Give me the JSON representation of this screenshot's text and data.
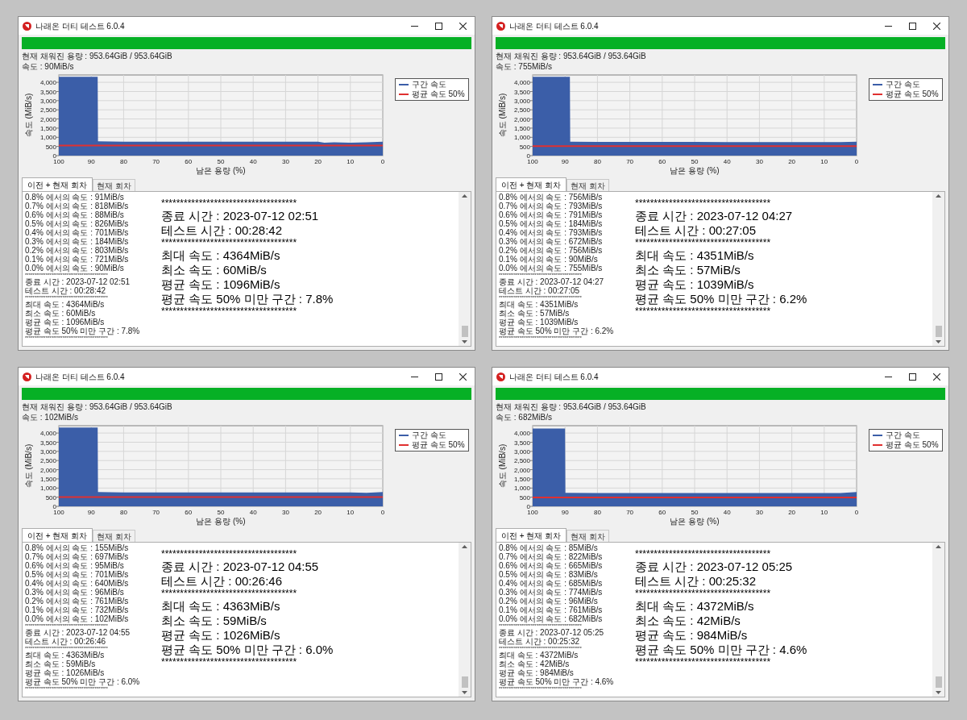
{
  "windows": [
    {
      "title": "나래온 더티 테스트 6.0.4",
      "progress": {
        "level": 1
      },
      "capacity": "현재 채워진 용량 : 953.64GiB / 953.64GiB",
      "speed": "속도 : 90MiB/s",
      "chart": {
        "chart_data": {
          "type": "area",
          "xlabel": "남은 용량 (%)",
          "ylabel": "속도 (MiB/s)",
          "x": [
            100,
            88,
            87.9,
            80,
            70,
            60,
            50,
            40,
            30,
            20,
            18,
            15,
            10,
            5,
            0
          ],
          "xlim": [
            100,
            0
          ],
          "ylim": [
            0,
            4400
          ],
          "xticks": [
            100,
            90,
            80,
            70,
            60,
            50,
            40,
            30,
            20,
            10,
            0
          ],
          "yticks": [
            {
              "value": 0,
              "label": "0"
            },
            {
              "value": 500,
              "label": "500"
            },
            {
              "value": 1000,
              "label": "1,000"
            },
            {
              "value": 1500,
              "label": "1,500"
            },
            {
              "value": 2000,
              "label": "2,000"
            },
            {
              "value": 2500,
              "label": "2,500"
            },
            {
              "value": 3000,
              "label": "3,000"
            },
            {
              "value": 3500,
              "label": "3,500"
            },
            {
              "value": 4000,
              "label": "4,000"
            }
          ],
          "series": [
            {
              "name": "구간 속도",
              "type": "area",
              "color": "#3b5ea8",
              "values": [
                4300,
                4300,
                780,
                760,
                760,
                760,
                760,
                760,
                760,
                760,
                700,
                720,
                700,
                720,
                760
              ]
            },
            {
              "name": "평균 속도 50%",
              "type": "line",
              "color": "#e03030",
              "values": [
                550,
                550,
                550,
                550,
                550,
                550,
                550,
                550,
                550,
                550,
                550,
                550,
                550,
                550,
                550
              ]
            }
          ],
          "grid": true
        }
      },
      "tabs": [
        {
          "label": "이전 + 현재 회차",
          "selected": true
        },
        {
          "label": "현재 회차",
          "selected": false
        }
      ],
      "log": [
        {
          "kind": "line",
          "text": "0.8% 에서의 속도 : 91MiB/s"
        },
        {
          "kind": "line",
          "text": "0.7% 에서의 속도 : 818MiB/s"
        },
        {
          "kind": "line",
          "text": "0.6% 에서의 속도 : 88MiB/s"
        },
        {
          "kind": "line",
          "text": "0.5% 에서의 속도 : 826MiB/s"
        },
        {
          "kind": "line",
          "text": "0.4% 에서의 속도 : 701MiB/s"
        },
        {
          "kind": "line",
          "text": "0.3% 에서의 속도 : 184MiB/s"
        },
        {
          "kind": "line",
          "text": "0.2% 에서의 속도 : 803MiB/s"
        },
        {
          "kind": "line",
          "text": "0.1% 에서의 속도 : 721MiB/s"
        },
        {
          "kind": "line",
          "text": "0.0% 에서의 속도 : 90MiB/s"
        },
        {
          "kind": "rule",
          "text": "********************************************"
        },
        {
          "kind": "line",
          "text": "종료 시간 : 2023-07-12 02:51"
        },
        {
          "kind": "line",
          "text": "테스트 시간 : 00:28:42"
        },
        {
          "kind": "rule",
          "text": "********************************************"
        },
        {
          "kind": "line",
          "text": "최대 속도 : 4364MiB/s"
        },
        {
          "kind": "line",
          "text": "최소 속도 : 60MiB/s"
        },
        {
          "kind": "line",
          "text": "평균 속도 : 1096MiB/s"
        },
        {
          "kind": "line",
          "text": "평균 속도 50% 미만 구간 : 7.8%"
        },
        {
          "kind": "rule",
          "text": "********************************************"
        }
      ],
      "summary": [
        {
          "kind": "rule",
          "text": "************************************"
        },
        {
          "kind": "line",
          "text": "종료 시간 : 2023-07-12 02:51"
        },
        {
          "kind": "line",
          "text": "테스트 시간 : 00:28:42"
        },
        {
          "kind": "rule",
          "text": "************************************"
        },
        {
          "kind": "line",
          "text": "최대 속도 : 4364MiB/s"
        },
        {
          "kind": "line",
          "text": "최소 속도 : 60MiB/s"
        },
        {
          "kind": "line",
          "text": "평균 속도 : 1096MiB/s"
        },
        {
          "kind": "line",
          "text": "평균 속도 50% 미만 구간 : 7.8%"
        },
        {
          "kind": "rule",
          "text": "************************************"
        }
      ]
    },
    {
      "title": "나래온 더티 테스트 6.0.4",
      "progress": {
        "level": 1
      },
      "capacity": "현재 채워진 용량 : 953.64GiB / 953.64GiB",
      "speed": "속도 : 755MiB/s",
      "chart": {
        "chart_data": {
          "type": "area",
          "xlabel": "남은 용량 (%)",
          "ylabel": "속도 (MiB/s)",
          "x": [
            100,
            88.5,
            88.4,
            80,
            70,
            60,
            50,
            40,
            30,
            20,
            18,
            15,
            10,
            5,
            0
          ],
          "xlim": [
            100,
            0
          ],
          "ylim": [
            0,
            4400
          ],
          "xticks": [
            100,
            90,
            80,
            70,
            60,
            50,
            40,
            30,
            20,
            10,
            0
          ],
          "yticks": [
            {
              "value": 0,
              "label": "0"
            },
            {
              "value": 500,
              "label": "500"
            },
            {
              "value": 1000,
              "label": "1,000"
            },
            {
              "value": 1500,
              "label": "1,500"
            },
            {
              "value": 2000,
              "label": "2,000"
            },
            {
              "value": 2500,
              "label": "2,500"
            },
            {
              "value": 3000,
              "label": "3,000"
            },
            {
              "value": 3500,
              "label": "3,500"
            },
            {
              "value": 4000,
              "label": "4,000"
            }
          ],
          "series": [
            {
              "name": "구간 속도",
              "type": "area",
              "color": "#3b5ea8",
              "values": [
                4300,
                4300,
                760,
                750,
                750,
                750,
                750,
                740,
                740,
                740,
                740,
                740,
                740,
                740,
                760
              ]
            },
            {
              "name": "평균 속도 50%",
              "type": "line",
              "color": "#e03030",
              "values": [
                520,
                520,
                520,
                520,
                520,
                520,
                520,
                520,
                520,
                520,
                520,
                520,
                520,
                520,
                520
              ]
            }
          ],
          "grid": true
        }
      },
      "tabs": [
        {
          "label": "이전 + 현재 회차",
          "selected": true
        },
        {
          "label": "현재 회차",
          "selected": false
        }
      ],
      "log": [
        {
          "kind": "line",
          "text": "0.8% 에서의 속도 : 756MiB/s"
        },
        {
          "kind": "line",
          "text": "0.7% 에서의 속도 : 793MiB/s"
        },
        {
          "kind": "line",
          "text": "0.6% 에서의 속도 : 791MiB/s"
        },
        {
          "kind": "line",
          "text": "0.5% 에서의 속도 : 184MiB/s"
        },
        {
          "kind": "line",
          "text": "0.4% 에서의 속도 : 793MiB/s"
        },
        {
          "kind": "line",
          "text": "0.3% 에서의 속도 : 672MiB/s"
        },
        {
          "kind": "line",
          "text": "0.2% 에서의 속도 : 756MiB/s"
        },
        {
          "kind": "line",
          "text": "0.1% 에서의 속도 : 90MiB/s"
        },
        {
          "kind": "line",
          "text": "0.0% 에서의 속도 : 755MiB/s"
        },
        {
          "kind": "rule",
          "text": "********************************************"
        },
        {
          "kind": "line",
          "text": "종료 시간 : 2023-07-12 04:27"
        },
        {
          "kind": "line",
          "text": "테스트 시간 : 00:27:05"
        },
        {
          "kind": "rule",
          "text": "********************************************"
        },
        {
          "kind": "line",
          "text": "최대 속도 : 4351MiB/s"
        },
        {
          "kind": "line",
          "text": "최소 속도 : 57MiB/s"
        },
        {
          "kind": "line",
          "text": "평균 속도 : 1039MiB/s"
        },
        {
          "kind": "line",
          "text": "평균 속도 50% 미만 구간 : 6.2%"
        },
        {
          "kind": "rule",
          "text": "********************************************"
        }
      ],
      "summary": [
        {
          "kind": "rule",
          "text": "************************************"
        },
        {
          "kind": "line",
          "text": "종료 시간 : 2023-07-12 04:27"
        },
        {
          "kind": "line",
          "text": "테스트 시간 : 00:27:05"
        },
        {
          "kind": "rule",
          "text": "************************************"
        },
        {
          "kind": "line",
          "text": "최대 속도 : 4351MiB/s"
        },
        {
          "kind": "line",
          "text": "최소 속도 : 57MiB/s"
        },
        {
          "kind": "line",
          "text": "평균 속도 : 1039MiB/s"
        },
        {
          "kind": "line",
          "text": "평균 속도 50% 미만 구간 : 6.2%"
        },
        {
          "kind": "rule",
          "text": "************************************"
        }
      ]
    },
    {
      "title": "나래온 더티 테스트 6.0.4",
      "progress": {
        "level": 1
      },
      "capacity": "현재 채워진 용량 : 953.64GiB / 953.64GiB",
      "speed": "속도 : 102MiB/s",
      "chart": {
        "chart_data": {
          "type": "area",
          "xlabel": "남은 용량 (%)",
          "ylabel": "속도 (MiB/s)",
          "x": [
            100,
            88,
            87.9,
            80,
            70,
            60,
            50,
            40,
            30,
            20,
            18,
            15,
            10,
            5,
            0
          ],
          "xlim": [
            100,
            0
          ],
          "ylim": [
            0,
            4400
          ],
          "xticks": [
            100,
            90,
            80,
            70,
            60,
            50,
            40,
            30,
            20,
            10,
            0
          ],
          "yticks": [
            {
              "value": 0,
              "label": "0"
            },
            {
              "value": 500,
              "label": "500"
            },
            {
              "value": 1000,
              "label": "1,000"
            },
            {
              "value": 1500,
              "label": "1,500"
            },
            {
              "value": 2000,
              "label": "2,000"
            },
            {
              "value": 2500,
              "label": "2,500"
            },
            {
              "value": 3000,
              "label": "3,000"
            },
            {
              "value": 3500,
              "label": "3,500"
            },
            {
              "value": 4000,
              "label": "4,000"
            }
          ],
          "series": [
            {
              "name": "구간 속도",
              "type": "area",
              "color": "#3b5ea8",
              "values": [
                4300,
                4300,
                780,
                760,
                760,
                760,
                760,
                760,
                760,
                760,
                760,
                760,
                760,
                740,
                780
              ]
            },
            {
              "name": "평균 속도 50%",
              "type": "line",
              "color": "#e03030",
              "values": [
                510,
                510,
                510,
                510,
                510,
                510,
                510,
                510,
                510,
                510,
                510,
                510,
                510,
                510,
                510
              ]
            }
          ],
          "grid": true
        }
      },
      "tabs": [
        {
          "label": "이전 + 현재 회차",
          "selected": true
        },
        {
          "label": "현재 회차",
          "selected": false
        }
      ],
      "log": [
        {
          "kind": "line",
          "text": "0.8% 에서의 속도 : 155MiB/s"
        },
        {
          "kind": "line",
          "text": "0.7% 에서의 속도 : 697MiB/s"
        },
        {
          "kind": "line",
          "text": "0.6% 에서의 속도 : 95MiB/s"
        },
        {
          "kind": "line",
          "text": "0.5% 에서의 속도 : 701MiB/s"
        },
        {
          "kind": "line",
          "text": "0.4% 에서의 속도 : 640MiB/s"
        },
        {
          "kind": "line",
          "text": "0.3% 에서의 속도 : 96MiB/s"
        },
        {
          "kind": "line",
          "text": "0.2% 에서의 속도 : 761MiB/s"
        },
        {
          "kind": "line",
          "text": "0.1% 에서의 속도 : 732MiB/s"
        },
        {
          "kind": "line",
          "text": "0.0% 에서의 속도 : 102MiB/s"
        },
        {
          "kind": "rule",
          "text": "********************************************"
        },
        {
          "kind": "line",
          "text": "종료 시간 : 2023-07-12 04:55"
        },
        {
          "kind": "line",
          "text": "테스트 시간 : 00:26:46"
        },
        {
          "kind": "rule",
          "text": "********************************************"
        },
        {
          "kind": "line",
          "text": "최대 속도 : 4363MiB/s"
        },
        {
          "kind": "line",
          "text": "최소 속도 : 59MiB/s"
        },
        {
          "kind": "line",
          "text": "평균 속도 : 1026MiB/s"
        },
        {
          "kind": "line",
          "text": "평균 속도 50% 미만 구간 : 6.0%"
        },
        {
          "kind": "rule",
          "text": "********************************************"
        }
      ],
      "summary": [
        {
          "kind": "rule",
          "text": "************************************"
        },
        {
          "kind": "line",
          "text": "종료 시간 : 2023-07-12 04:55"
        },
        {
          "kind": "line",
          "text": "테스트 시간 : 00:26:46"
        },
        {
          "kind": "rule",
          "text": "************************************"
        },
        {
          "kind": "line",
          "text": "최대 속도 : 4363MiB/s"
        },
        {
          "kind": "line",
          "text": "최소 속도 : 59MiB/s"
        },
        {
          "kind": "line",
          "text": "평균 속도 : 1026MiB/s"
        },
        {
          "kind": "line",
          "text": "평균 속도 50% 미만 구간 : 6.0%"
        },
        {
          "kind": "rule",
          "text": "************************************"
        }
      ]
    },
    {
      "title": "나래온 더티 테스트 6.0.4",
      "progress": {
        "level": 1
      },
      "capacity": "현재 채워진 용량 : 953.64GiB / 953.64GiB",
      "speed": "속도 : 682MiB/s",
      "chart": {
        "chart_data": {
          "type": "area",
          "xlabel": "남은 용량 (%)",
          "ylabel": "속도 (MiB/s)",
          "x": [
            100,
            90,
            89.9,
            80,
            70,
            60,
            50,
            40,
            30,
            20,
            18,
            15,
            10,
            5,
            0
          ],
          "xlim": [
            100,
            0
          ],
          "ylim": [
            0,
            4400
          ],
          "xticks": [
            100,
            90,
            80,
            70,
            60,
            50,
            40,
            30,
            20,
            10,
            0
          ],
          "yticks": [
            {
              "value": 0,
              "label": "0"
            },
            {
              "value": 500,
              "label": "500"
            },
            {
              "value": 1000,
              "label": "1,000"
            },
            {
              "value": 1500,
              "label": "1,500"
            },
            {
              "value": 2000,
              "label": "2,000"
            },
            {
              "value": 2500,
              "label": "2,500"
            },
            {
              "value": 3000,
              "label": "3,000"
            },
            {
              "value": 3500,
              "label": "3,500"
            },
            {
              "value": 4000,
              "label": "4,000"
            }
          ],
          "series": [
            {
              "name": "구간 속도",
              "type": "area",
              "color": "#3b5ea8",
              "values": [
                4250,
                4250,
                740,
                730,
                730,
                730,
                730,
                730,
                730,
                730,
                730,
                730,
                730,
                720,
                780
              ]
            },
            {
              "name": "평균 속도 50%",
              "type": "line",
              "color": "#e03030",
              "values": [
                490,
                490,
                490,
                490,
                490,
                490,
                490,
                490,
                490,
                490,
                490,
                490,
                490,
                490,
                490
              ]
            }
          ],
          "grid": true
        }
      },
      "tabs": [
        {
          "label": "이전 + 현재 회차",
          "selected": true
        },
        {
          "label": "현재 회차",
          "selected": false
        }
      ],
      "log": [
        {
          "kind": "line",
          "text": "0.8% 에서의 속도 : 85MiB/s"
        },
        {
          "kind": "line",
          "text": "0.7% 에서의 속도 : 822MiB/s"
        },
        {
          "kind": "line",
          "text": "0.6% 에서의 속도 : 665MiB/s"
        },
        {
          "kind": "line",
          "text": "0.5% 에서의 속도 : 83MiB/s"
        },
        {
          "kind": "line",
          "text": "0.4% 에서의 속도 : 685MiB/s"
        },
        {
          "kind": "line",
          "text": "0.3% 에서의 속도 : 774MiB/s"
        },
        {
          "kind": "line",
          "text": "0.2% 에서의 속도 : 96MiB/s"
        },
        {
          "kind": "line",
          "text": "0.1% 에서의 속도 : 761MiB/s"
        },
        {
          "kind": "line",
          "text": "0.0% 에서의 속도 : 682MiB/s"
        },
        {
          "kind": "rule",
          "text": "********************************************"
        },
        {
          "kind": "line",
          "text": "종료 시간 : 2023-07-12 05:25"
        },
        {
          "kind": "line",
          "text": "테스트 시간 : 00:25:32"
        },
        {
          "kind": "rule",
          "text": "********************************************"
        },
        {
          "kind": "line",
          "text": "최대 속도 : 4372MiB/s"
        },
        {
          "kind": "line",
          "text": "최소 속도 : 42MiB/s"
        },
        {
          "kind": "line",
          "text": "평균 속도 : 984MiB/s"
        },
        {
          "kind": "line",
          "text": "평균 속도 50% 미만 구간 : 4.6%"
        },
        {
          "kind": "rule",
          "text": "********************************************"
        }
      ],
      "summary": [
        {
          "kind": "rule",
          "text": "************************************"
        },
        {
          "kind": "line",
          "text": "종료 시간 : 2023-07-12 05:25"
        },
        {
          "kind": "line",
          "text": "테스트 시간 : 00:25:32"
        },
        {
          "kind": "rule",
          "text": "************************************"
        },
        {
          "kind": "line",
          "text": "최대 속도 : 4372MiB/s"
        },
        {
          "kind": "line",
          "text": "최소 속도 : 42MiB/s"
        },
        {
          "kind": "line",
          "text": "평균 속도 : 984MiB/s"
        },
        {
          "kind": "line",
          "text": "평균 속도 50% 미만 구간 : 4.6%"
        },
        {
          "kind": "rule",
          "text": "************************************"
        }
      ]
    }
  ]
}
